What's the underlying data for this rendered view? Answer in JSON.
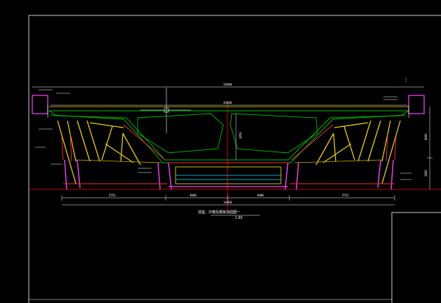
{
  "drawing": {
    "title": "挂篮、外模及模板加固图一",
    "scale": "1:60"
  },
  "dimensions": {
    "top_overall": "28400",
    "top_inner": "26600",
    "bottom_total": "14800",
    "bottom_seg_1": "5551",
    "bottom_seg_2": "4000",
    "bottom_seg_3": "4000",
    "bottom_seg_4": "5551",
    "center_height": "2850",
    "right_height_upper": "4800",
    "right_height_lower": "1800"
  },
  "colors": {
    "background": "#000000",
    "frame": "#ffffff",
    "box_girder": "#00c000",
    "truss_yellow": "#e8d000",
    "truss_red": "#ff3030",
    "member_magenta": "#ff40ff",
    "center_line": "#ff0000",
    "cyan": "#00e0ff"
  }
}
